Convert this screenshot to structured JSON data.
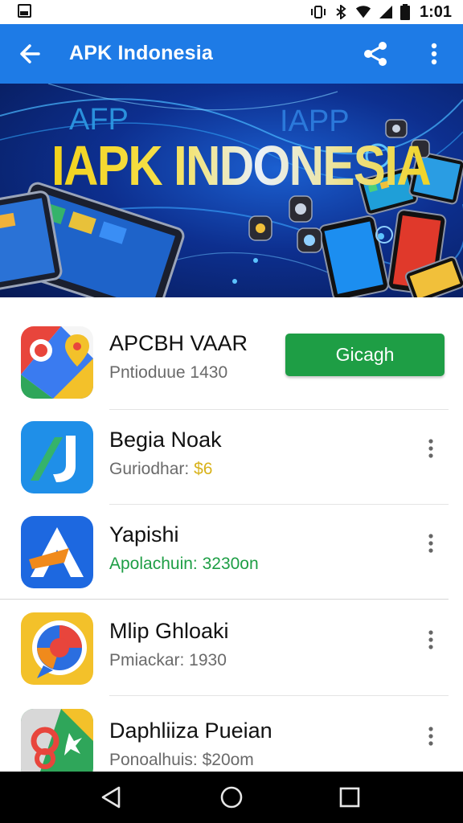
{
  "status_bar": {
    "time": "1:01",
    "icons": [
      "notification-icon",
      "vibrate-icon",
      "bluetooth-icon",
      "wifi-icon",
      "signal-icon",
      "battery-icon"
    ]
  },
  "app_bar": {
    "title": "APK Indonesia",
    "color": "#1e7be6",
    "icons": [
      "back-arrow-icon",
      "share-icon",
      "more-vert-icon"
    ]
  },
  "banner": {
    "small_left": "AFP",
    "small_right": "IAPP",
    "headline": "IAPK INDONESIA"
  },
  "apps": [
    {
      "name": "APCBH VAAR",
      "subtitle": "Pntioduue 1430",
      "icon": "maps-icon",
      "action": "Gicagh",
      "subtitle_color": "#6a6a6a"
    },
    {
      "name": "Begia Noak",
      "subtitle_prefix": "Guriodhar: ",
      "subtitle_value": "$6",
      "icon": "j-app-icon",
      "subtitle_color": "#6a6a6a",
      "value_color": "#d8b21a"
    },
    {
      "name": "Yapishi",
      "subtitle": "Apolachuin: 3230on",
      "icon": "a-app-icon",
      "subtitle_color": "#1e9e45"
    },
    {
      "name": "Mlip Ghloaki",
      "subtitle": "Pmiackar: 1930",
      "icon": "chat-bubble-icon",
      "subtitle_color": "#6a6a6a"
    },
    {
      "name": "Daphliiza Pueian",
      "subtitle": "Ponoalhuis: $20om",
      "icon": "puzzle-app-icon",
      "subtitle_color": "#6a6a6a"
    }
  ],
  "nav_bar": {
    "icons": [
      "back-triangle-icon",
      "home-circle-icon",
      "recents-square-icon"
    ]
  },
  "colors": {
    "accent": "#1e7be6",
    "install_button": "#1e9e45",
    "headline_yellow": "#f2d21b"
  }
}
